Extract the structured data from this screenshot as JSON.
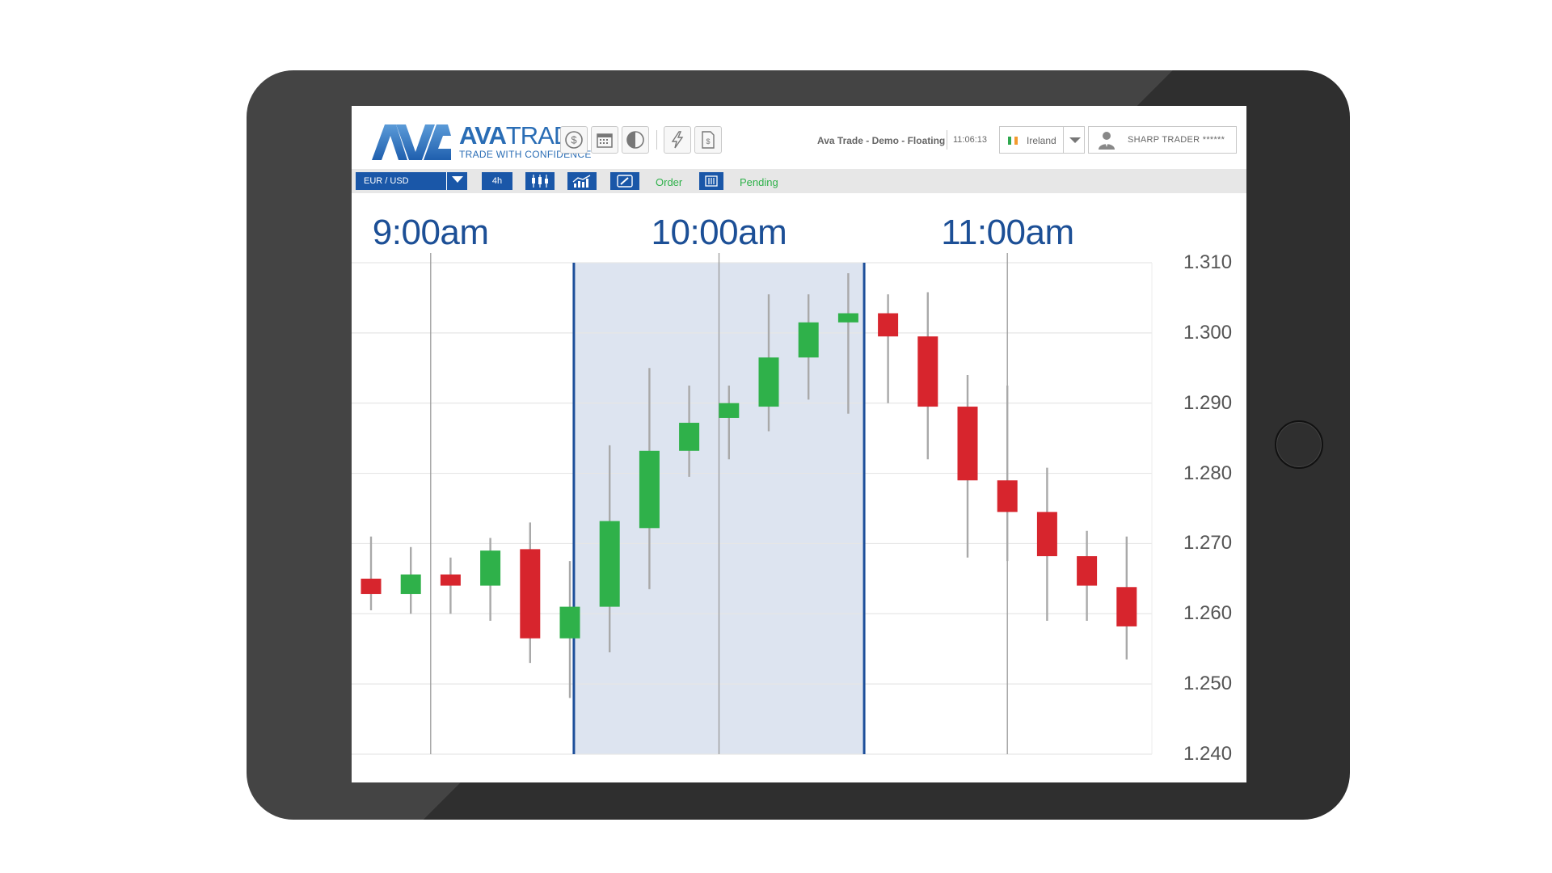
{
  "header": {
    "brand_part1": "AVA",
    "brand_part2": "TRADE",
    "tagline": "TRADE WITH CONFIDENCE",
    "icons": [
      "dollar-icon",
      "calendar-icon",
      "contrast-icon",
      "lightning-icon",
      "document-icon"
    ],
    "server": "Ava Trade - Demo - Floating",
    "time": "11:06:13",
    "region": "Ireland",
    "user": "SHARP TRADER ******"
  },
  "toolbar": {
    "pair": "EUR / USD",
    "timeframe": "4h",
    "order_label": "Order",
    "pending_label": "Pending",
    "icons": [
      "candlestick-icon",
      "line-chart-icon",
      "edit-icon",
      "pending-list-icon"
    ]
  },
  "colors": {
    "accent": "#1a57a8",
    "time_text": "#1c4f96",
    "bull": "#2fb14a",
    "bear": "#d7252d",
    "highlight": "#dde4f0",
    "highlight_border": "#1d4f9a",
    "frame": "#2f2f2f"
  },
  "chart_data": {
    "type": "candlestick",
    "time_labels": [
      {
        "label": "9:00am",
        "index": 1.5
      },
      {
        "label": "10:00am",
        "index": 8.75
      },
      {
        "label": "11:00am",
        "index": 16
      }
    ],
    "highlight_range": {
      "from_index": 5.1,
      "to_index": 12.4
    },
    "ylim": [
      1.24,
      1.31
    ],
    "yticks": [
      "1.310",
      "1.300",
      "1.290",
      "1.280",
      "1.270",
      "1.260",
      "1.250",
      "1.240"
    ],
    "grid": true,
    "candles": [
      {
        "o": 1.265,
        "h": 1.271,
        "l": 1.2605,
        "c": 1.2628
      },
      {
        "o": 1.2628,
        "h": 1.2695,
        "l": 1.26,
        "c": 1.2656
      },
      {
        "o": 1.2656,
        "h": 1.268,
        "l": 1.26,
        "c": 1.264
      },
      {
        "o": 1.264,
        "h": 1.2708,
        "l": 1.259,
        "c": 1.269
      },
      {
        "o": 1.2692,
        "h": 1.273,
        "l": 1.253,
        "c": 1.2565
      },
      {
        "o": 1.2565,
        "h": 1.2675,
        "l": 1.248,
        "c": 1.261
      },
      {
        "o": 1.261,
        "h": 1.284,
        "l": 1.2545,
        "c": 1.2732
      },
      {
        "o": 1.2722,
        "h": 1.295,
        "l": 1.2635,
        "c": 1.2832
      },
      {
        "o": 1.2832,
        "h": 1.2925,
        "l": 1.2795,
        "c": 1.2872
      },
      {
        "o": 1.2879,
        "h": 1.2925,
        "l": 1.282,
        "c": 1.29
      },
      {
        "o": 1.2895,
        "h": 1.3055,
        "l": 1.286,
        "c": 1.2965
      },
      {
        "o": 1.2965,
        "h": 1.3055,
        "l": 1.2905,
        "c": 1.3015
      },
      {
        "o": 1.3015,
        "h": 1.3085,
        "l": 1.2885,
        "c": 1.3028
      },
      {
        "o": 1.3028,
        "h": 1.3055,
        "l": 1.29,
        "c": 1.2995
      },
      {
        "o": 1.2995,
        "h": 1.3058,
        "l": 1.282,
        "c": 1.2895
      },
      {
        "o": 1.2895,
        "h": 1.294,
        "l": 1.268,
        "c": 1.279
      },
      {
        "o": 1.279,
        "h": 1.2925,
        "l": 1.2675,
        "c": 1.2745
      },
      {
        "o": 1.2745,
        "h": 1.2808,
        "l": 1.259,
        "c": 1.2682
      },
      {
        "o": 1.2682,
        "h": 1.2718,
        "l": 1.259,
        "c": 1.264
      },
      {
        "o": 1.2638,
        "h": 1.271,
        "l": 1.2535,
        "c": 1.2582
      }
    ]
  }
}
